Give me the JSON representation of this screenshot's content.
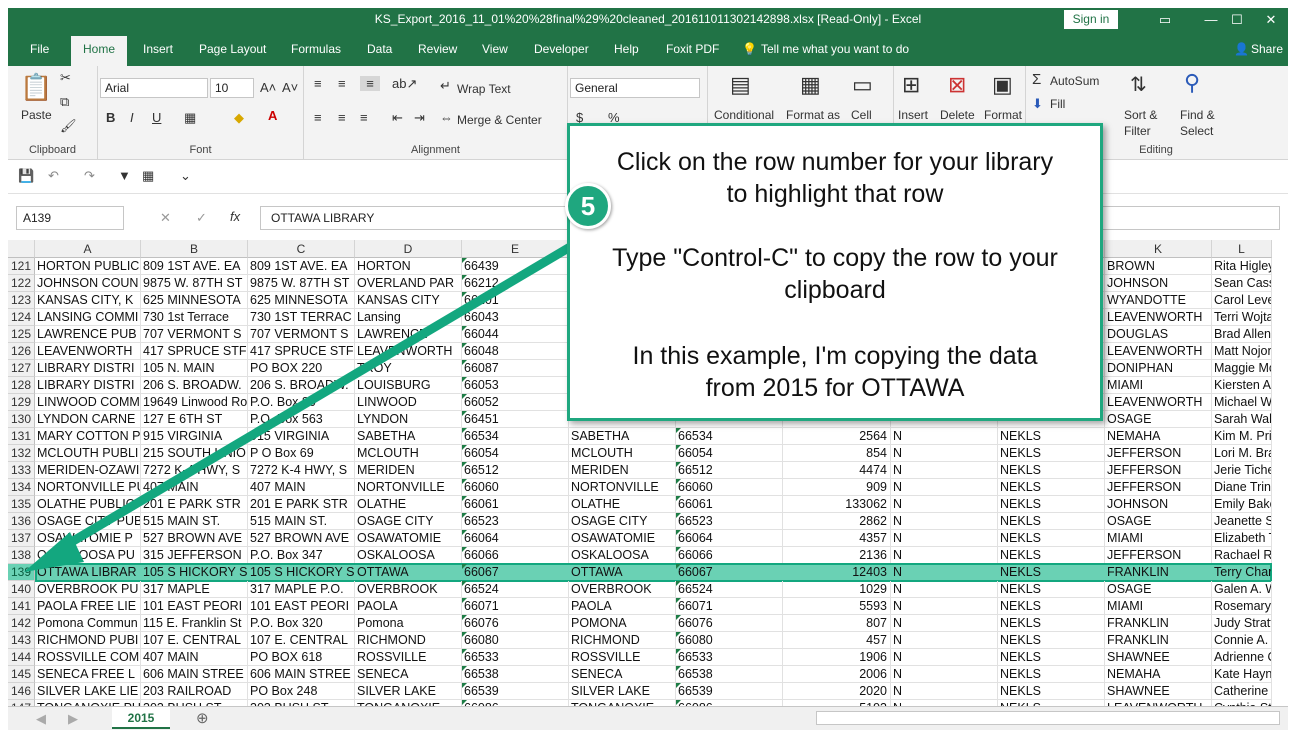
{
  "window": {
    "title": "KS_Export_2016_11_01%20%28final%29%20cleaned_20161101130214289‌8.xlsx  [Read-Only]  -  Excel",
    "signin_label": "Sign in"
  },
  "menu": {
    "tabs": [
      "File",
      "Home",
      "Insert",
      "Page Layout",
      "Formulas",
      "Data",
      "Review",
      "View",
      "Developer",
      "Help",
      "Foxit PDF"
    ],
    "tell_me": "Tell me what you want to do",
    "share": "Share"
  },
  "ribbon": {
    "clipboard": {
      "paste": "Paste",
      "label": "Clipboard"
    },
    "font": {
      "name": "Arial",
      "size": "10",
      "label": "Font"
    },
    "alignment": {
      "wrap_text": "Wrap Text",
      "merge_center": "Merge & Center",
      "label": "Alignment"
    },
    "number": {
      "format": "General"
    },
    "styles": {
      "conditional": "Conditional",
      "format_as": "Format as",
      "cell": "Cell"
    },
    "cells": {
      "insert": "Insert",
      "delete": "Delete",
      "format": "Format"
    },
    "editing": {
      "autosum": "AutoSum",
      "fill": "Fill",
      "sort_filter": "Sort &",
      "filter": "Filter",
      "find_select": "Find &",
      "select": "Select",
      "label": "Editing"
    }
  },
  "formula_bar": {
    "name_box": "A139",
    "formula": "OTTAWA LIBRARY"
  },
  "columns": [
    "A",
    "B",
    "C",
    "D",
    "E",
    "F",
    "G",
    "H",
    "I",
    "J",
    "K",
    "L"
  ],
  "rows": [
    {
      "n": "121",
      "a": "HORTON PUBLIC",
      "b": "809 1ST AVE. EA",
      "c": "809 1ST AVE. EA",
      "d": "HORTON",
      "e": "66439",
      "f": "",
      "g": "",
      "h": "",
      "i": "",
      "j": "",
      "k": "BROWN",
      "l": "Rita Higley"
    },
    {
      "n": "122",
      "a": "JOHNSON COUN",
      "b": "9875 W. 87TH ST",
      "c": "9875 W. 87TH ST",
      "d": "OVERLAND PAR",
      "e": "66212",
      "f": "",
      "g": "",
      "h": "",
      "i": "",
      "j": "",
      "k": "JOHNSON",
      "l": "Sean Casse"
    },
    {
      "n": "123",
      "a": "KANSAS CITY, K",
      "b": "625 MINNESOTA",
      "c": "625 MINNESOTA",
      "d": "KANSAS CITY",
      "e": "66101",
      "f": "",
      "g": "",
      "h": "",
      "i": "",
      "j": "",
      "k": "WYANDOTTE",
      "l": "Carol Levers"
    },
    {
      "n": "124",
      "a": "LANSING COMMI",
      "b": "730 1st Terrace",
      "c": "730 1ST TERRAC",
      "d": "Lansing",
      "e": "66043",
      "f": "",
      "g": "",
      "h": "",
      "i": "",
      "j": "",
      "k": "LEAVENWORTH",
      "l": "Terri Wojtale"
    },
    {
      "n": "125",
      "a": "LAWRENCE PUB",
      "b": "707 VERMONT S",
      "c": "707 VERMONT S",
      "d": "LAWRENCE",
      "e": "66044",
      "f": "",
      "g": "",
      "h": "",
      "i": "",
      "j": "",
      "k": "DOUGLAS",
      "l": "Brad Allen"
    },
    {
      "n": "126",
      "a": "LEAVENWORTH",
      "b": "417 SPRUCE STF",
      "c": "417 SPRUCE STF",
      "d": "LEAVENWORTH",
      "e": "66048",
      "f": "",
      "g": "",
      "h": "",
      "i": "",
      "j": "",
      "k": "LEAVENWORTH",
      "l": "Matt Nojone"
    },
    {
      "n": "127",
      "a": "LIBRARY DISTRI",
      "b": "105 N. MAIN",
      "c": "PO BOX 220",
      "d": "TROY",
      "e": "66087",
      "f": "",
      "g": "",
      "h": "",
      "i": "",
      "j": "",
      "k": "DONIPHAN",
      "l": "Maggie McK"
    },
    {
      "n": "128",
      "a": "LIBRARY DISTRI",
      "b": "206 S. BROADW.",
      "c": "206 S. BROADW.",
      "d": "LOUISBURG",
      "e": "66053",
      "f": "",
      "g": "",
      "h": "",
      "i": "",
      "j": "",
      "k": "MIAMI",
      "l": "Kiersten Alle"
    },
    {
      "n": "129",
      "a": "LINWOOD COMM",
      "b": "19649 Linwood Ro",
      "c": "P.O. Box 80",
      "d": "LINWOOD",
      "e": "66052",
      "f": "",
      "g": "",
      "h": "",
      "i": "",
      "j": "",
      "k": "LEAVENWORTH",
      "l": "Michael Wa"
    },
    {
      "n": "130",
      "a": "LYNDON CARNE",
      "b": "127 E 6TH ST",
      "c": "P.O. Box 563",
      "d": "LYNDON",
      "e": "66451",
      "f": "",
      "g": "",
      "h": "",
      "i": "",
      "j": "",
      "k": "OSAGE",
      "l": "Sarah Walk"
    },
    {
      "n": "131",
      "a": "MARY COTTON P",
      "b": "915 VIRGINIA",
      "c": "915 VIRGINIA",
      "d": "SABETHA",
      "e": "66534",
      "f": "SABETHA",
      "g": "66534",
      "h": "2564",
      "i": "N",
      "j": "NEKLS",
      "k": "NEMAHA",
      "l": "Kim M. Prie"
    },
    {
      "n": "132",
      "a": "MCLOUTH PUBLI",
      "b": "215 SOUTH UNIO",
      "c": "P O Box 69",
      "d": "MCLOUTH",
      "e": "66054",
      "f": "MCLOUTH",
      "g": "66054",
      "h": "854",
      "i": "N",
      "j": "NEKLS",
      "k": "JEFFERSON",
      "l": "Lori M. Brau"
    },
    {
      "n": "133",
      "a": "MERIDEN-OZAWI",
      "b": "7272 K-4 HWY, S",
      "c": "7272 K-4 HWY, S",
      "d": "MERIDEN",
      "e": "66512",
      "f": "MERIDEN",
      "g": "66512",
      "h": "4474",
      "i": "N",
      "j": "NEKLS",
      "k": "JEFFERSON",
      "l": "Jerie Tichen"
    },
    {
      "n": "134",
      "a": "NORTONVILLE PU",
      "b": "407 MAIN",
      "c": "407 MAIN",
      "d": "NORTONVILLE",
      "e": "66060",
      "f": "NORTONVILLE",
      "g": "66060",
      "h": "909",
      "i": "N",
      "j": "NEKLS",
      "k": "JEFFERSON",
      "l": "Diane Trinkl"
    },
    {
      "n": "135",
      "a": "OLATHE PUBLIC",
      "b": "201 E PARK STR",
      "c": "201 E PARK STR",
      "d": "OLATHE",
      "e": "66061",
      "f": "OLATHE",
      "g": "66061",
      "h": "133062",
      "i": "N",
      "j": "NEKLS",
      "k": "JOHNSON",
      "l": "Emily Baker"
    },
    {
      "n": "136",
      "a": "OSAGE CITY PUB",
      "b": "515 MAIN ST.",
      "c": "515 MAIN ST.",
      "d": "OSAGE CITY",
      "e": "66523",
      "f": "OSAGE CITY",
      "g": "66523",
      "h": "2862",
      "i": "N",
      "j": "NEKLS",
      "k": "OSAGE",
      "l": "Jeanette Str"
    },
    {
      "n": "137",
      "a": "OSAWATOMIE P",
      "b": "527 BROWN AVE",
      "c": "527 BROWN AVE",
      "d": "OSAWATOMIE",
      "e": "66064",
      "f": "OSAWATOMIE",
      "g": "66064",
      "h": "4357",
      "i": "N",
      "j": "NEKLS",
      "k": "MIAMI",
      "l": "Elizabeth Tr"
    },
    {
      "n": "138",
      "a": "OSKALOOSA PU",
      "b": "315 JEFFERSON",
      "c": "P.O. Box 347",
      "d": "OSKALOOSA",
      "e": "66066",
      "f": "OSKALOOSA",
      "g": "66066",
      "h": "2136",
      "i": "N",
      "j": "NEKLS",
      "k": "JEFFERSON",
      "l": "Rachael R."
    },
    {
      "n": "139",
      "a": "OTTAWA LIBRAR",
      "b": "105 S HICKORY S",
      "c": "105 S HICKORY S",
      "d": "OTTAWA",
      "e": "66067",
      "f": "OTTAWA",
      "g": "66067",
      "h": "12403",
      "i": "N",
      "j": "NEKLS",
      "k": "FRANKLIN",
      "l": "Terry Chartie"
    },
    {
      "n": "140",
      "a": "OVERBROOK PU",
      "b": "317 MAPLE",
      "c": "317 MAPLE P.O.",
      "d": "OVERBROOK",
      "e": "66524",
      "f": "OVERBROOK",
      "g": "66524",
      "h": "1029",
      "i": "N",
      "j": "NEKLS",
      "k": "OSAGE",
      "l": "Galen A. W"
    },
    {
      "n": "141",
      "a": "PAOLA FREE LIE",
      "b": "101 EAST PEORI",
      "c": "101 EAST PEORI",
      "d": "PAOLA",
      "e": "66071",
      "f": "PAOLA",
      "g": "66071",
      "h": "5593",
      "i": "N",
      "j": "NEKLS",
      "k": "MIAMI",
      "l": "Rosemary J"
    },
    {
      "n": "142",
      "a": "Pomona Commun",
      "b": "115 E. Franklin St",
      "c": "P.O. Box 320",
      "d": "Pomona",
      "e": "66076",
      "f": "POMONA",
      "g": "66076",
      "h": "807",
      "i": "N",
      "j": "NEKLS",
      "k": "FRANKLIN",
      "l": "Judy Stratto"
    },
    {
      "n": "143",
      "a": "RICHMOND PUBI",
      "b": "107 E. CENTRAL",
      "c": "107 E. CENTRAL",
      "d": "RICHMOND",
      "e": "66080",
      "f": "RICHMOND",
      "g": "66080",
      "h": "457",
      "i": "N",
      "j": "NEKLS",
      "k": "FRANKLIN",
      "l": "Connie A. W"
    },
    {
      "n": "144",
      "a": "ROSSVILLE COM",
      "b": "407 MAIN",
      "c": "PO BOX 618",
      "d": "ROSSVILLE",
      "e": "66533",
      "f": "ROSSVILLE",
      "g": "66533",
      "h": "1906",
      "i": "N",
      "j": "NEKLS",
      "k": "SHAWNEE",
      "l": "Adrienne Ol"
    },
    {
      "n": "145",
      "a": "SENECA FREE L",
      "b": "606 MAIN STREE",
      "c": "606 MAIN STREE",
      "d": "SENECA",
      "e": "66538",
      "f": "SENECA",
      "g": "66538",
      "h": "2006",
      "i": "N",
      "j": "NEKLS",
      "k": "NEMAHA",
      "l": "Kate Haynie"
    },
    {
      "n": "146",
      "a": "SILVER LAKE LIE",
      "b": "203 RAILROAD",
      "c": "PO Box 248",
      "d": "SILVER LAKE",
      "e": "66539",
      "f": "SILVER LAKE",
      "g": "66539",
      "h": "2020",
      "i": "N",
      "j": "NEKLS",
      "k": "SHAWNEE",
      "l": "Catherine N"
    },
    {
      "n": "147",
      "a": "TONGANOXIE PU",
      "b": "303 BUSH ST",
      "c": "303 BUSH ST",
      "d": "TONGANOXIE",
      "e": "66086",
      "f": "TONGANOXIE",
      "g": "66086",
      "h": "5193",
      "i": "N",
      "j": "NEKLS",
      "k": "LEAVENWORTH",
      "l": "Cynthia Sta"
    }
  ],
  "selected_row": "139",
  "sheet": {
    "tab": "2015"
  },
  "callout": {
    "step": "5",
    "line1": "Click on the row number for your library",
    "line2": "to highlight that row",
    "line3": "Type \"Control-C\" to copy the row to your",
    "line4": "clipboard",
    "line5": "In this example, I'm copying the data",
    "line6": "from 2015 for OTTAWA"
  },
  "colors": {
    "excel_green": "#217346",
    "accent_teal": "#1fa77f",
    "selection_fill": "#6ad1b4"
  }
}
